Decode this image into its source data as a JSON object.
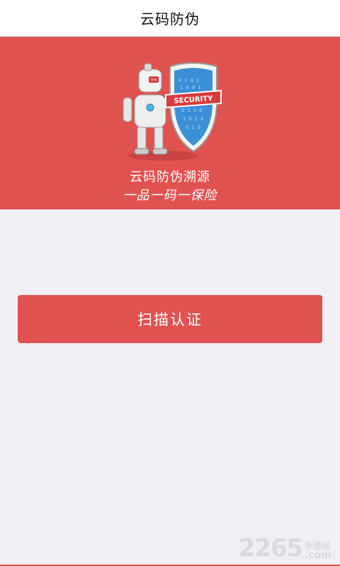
{
  "top_bar": {
    "title": "云码防伪"
  },
  "hero": {
    "background_color": "#e05250",
    "shield_text": "SECURITY",
    "robot_badge": "YH",
    "slogan_line1": "云码防伪溯源",
    "slogan_line2": "一品一码一保险"
  },
  "main": {
    "scan_button_label": "扫描认证"
  },
  "watermark": {
    "number": "2265",
    "cn": "手游网",
    "com": ".com"
  }
}
